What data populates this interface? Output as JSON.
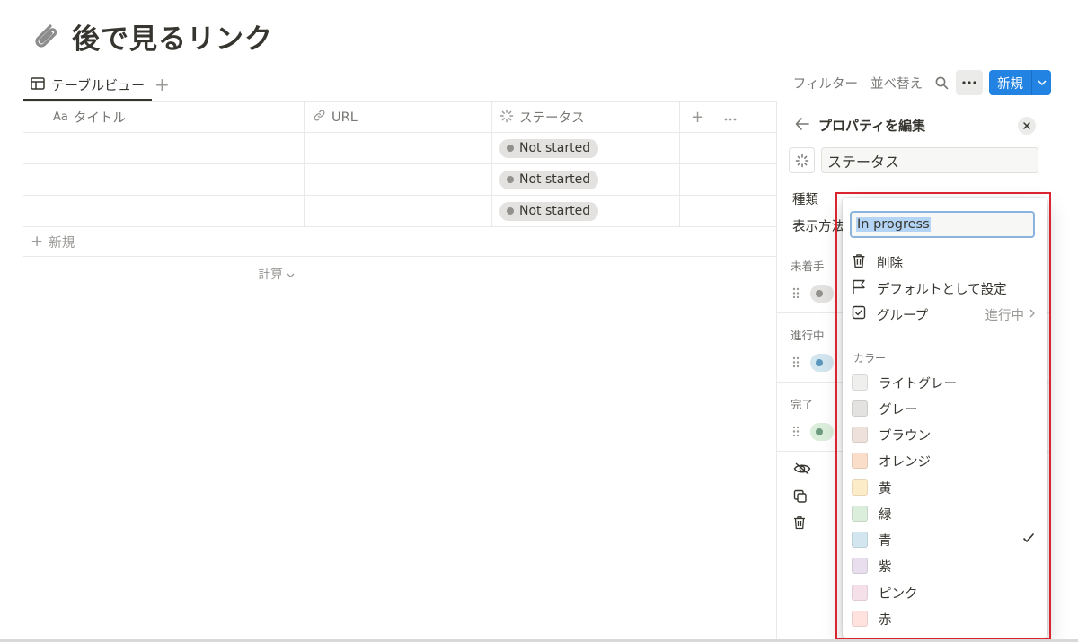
{
  "page": {
    "title": "後で見るリンク"
  },
  "view_tab": {
    "label": "テーブルビュー"
  },
  "toolbar": {
    "filter": "フィルター",
    "sort": "並べ替え",
    "new": "新規"
  },
  "table": {
    "columns": [
      {
        "prefix": "Aa",
        "label": "タイトル"
      },
      {
        "label": "URL"
      },
      {
        "label": "ステータス"
      }
    ],
    "rows": [
      {
        "status": "Not started"
      },
      {
        "status": "Not started"
      },
      {
        "status": "Not started"
      }
    ],
    "new_row": "新規",
    "calc": "計算"
  },
  "panel": {
    "title": "プロパティを編集",
    "name_value": "ステータス",
    "type_label": "種類",
    "display_label": "表示方法",
    "groups": [
      {
        "label": "未着手",
        "color": "#e3e2e0",
        "dot": "#91918e"
      },
      {
        "label": "進行中",
        "color": "#d3e5ef",
        "dot": "#5b97bd"
      },
      {
        "label": "完了",
        "color": "#dbeddb",
        "dot": "#6c9b7d"
      }
    ]
  },
  "menu": {
    "input_value": "In progress",
    "delete": "削除",
    "set_default": "デフォルトとして設定",
    "group": "グループ",
    "group_value": "進行中",
    "color_section": "カラー",
    "colors": [
      {
        "label": "ライトグレー",
        "hex": "#efefee"
      },
      {
        "label": "グレー",
        "hex": "#e3e2e0"
      },
      {
        "label": "ブラウン",
        "hex": "#eee0da"
      },
      {
        "label": "オレンジ",
        "hex": "#fadec9"
      },
      {
        "label": "黄",
        "hex": "#fdecc8"
      },
      {
        "label": "緑",
        "hex": "#dbeddb"
      },
      {
        "label": "青",
        "hex": "#d3e5ef",
        "selected": true
      },
      {
        "label": "紫",
        "hex": "#e8deee"
      },
      {
        "label": "ピンク",
        "hex": "#f5e0e9"
      },
      {
        "label": "赤",
        "hex": "#ffe2dd"
      }
    ]
  }
}
